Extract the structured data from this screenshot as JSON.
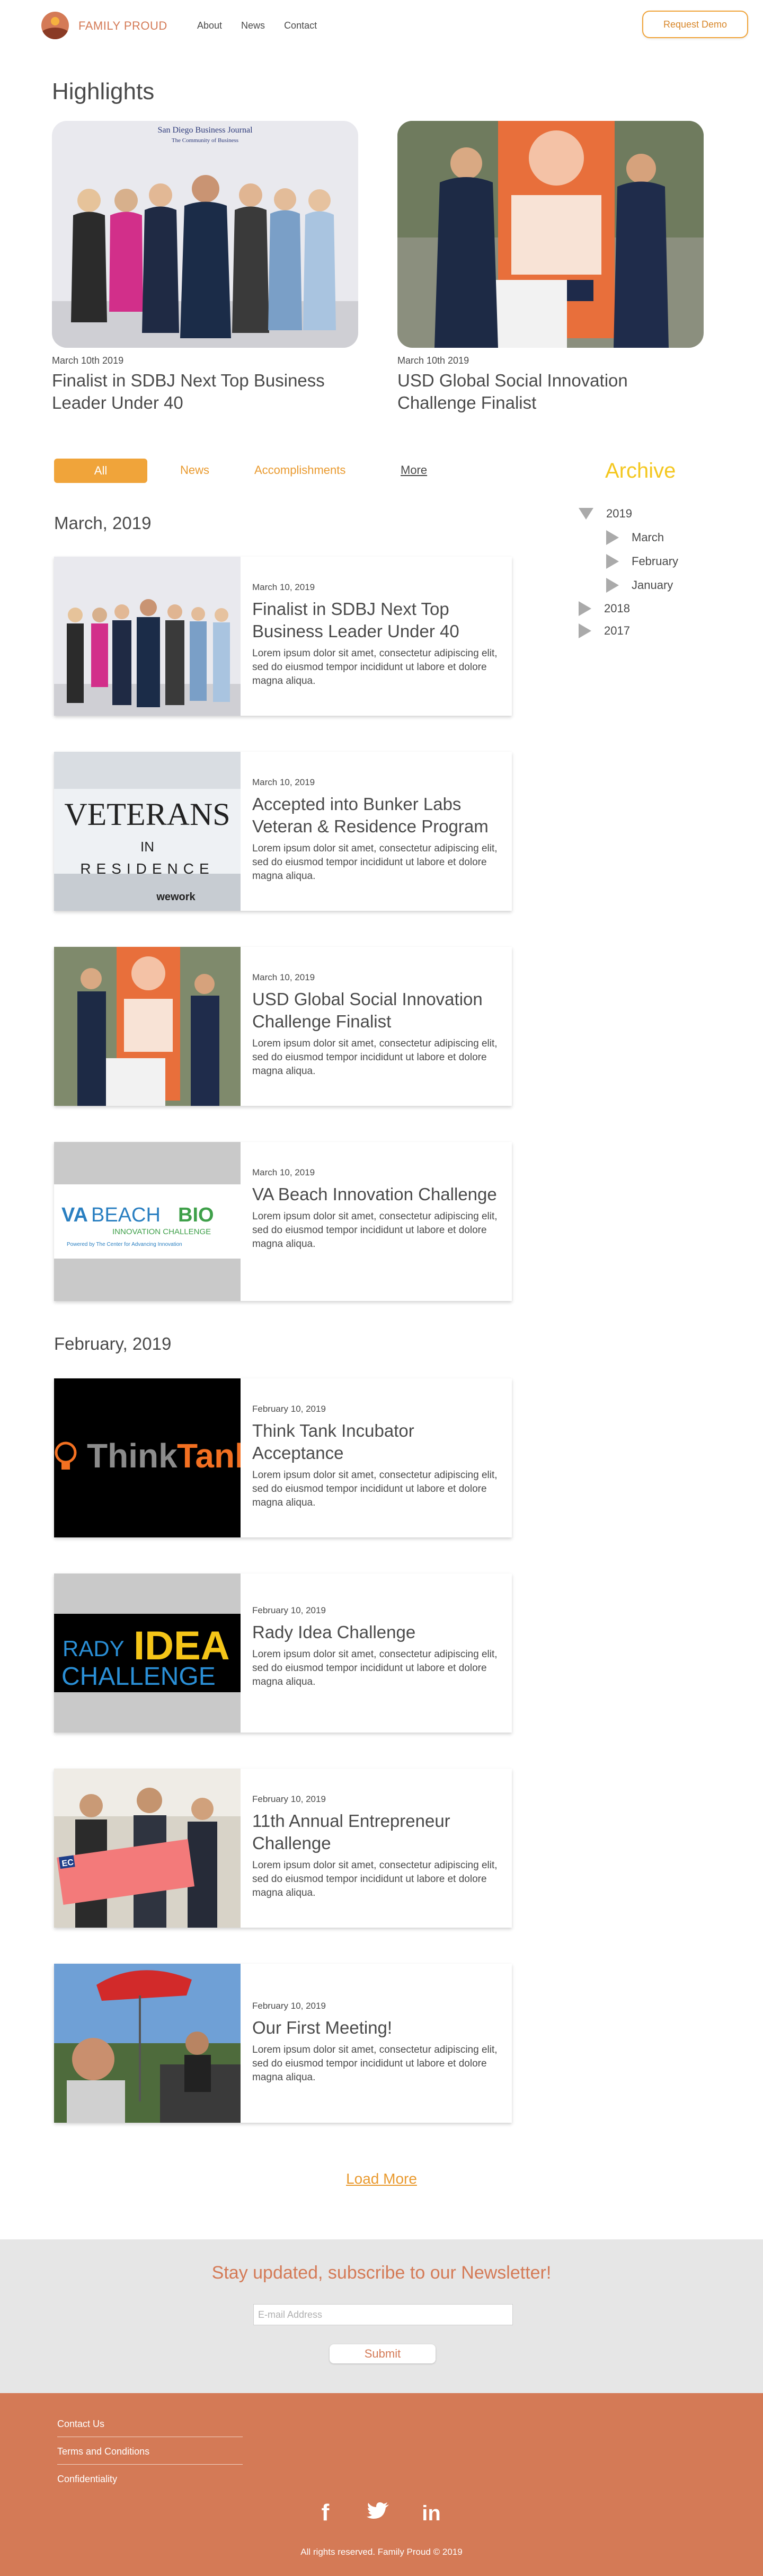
{
  "nav": {
    "brand": "FAMILY PROUD",
    "links": [
      "About",
      "News",
      "Contact"
    ],
    "demo_button": "Request Demo"
  },
  "highlights": {
    "title": "Highlights",
    "items": [
      {
        "date": "March 10th 2019",
        "headline": "Finalist in SDBJ Next Top Business Leader Under 40",
        "banner_line1": "San Diego Business Journal",
        "banner_line2": "The Community of Business"
      },
      {
        "date": "March 10th 2019",
        "headline": "USD Global Social Innovation Challenge Finalist"
      }
    ]
  },
  "filters": {
    "all": "All",
    "news": "News",
    "accomplishments": "Accomplishments",
    "more": "More"
  },
  "archive": {
    "title": "Archive",
    "year_2019": "2019",
    "months": [
      "March",
      "February",
      "January"
    ],
    "year_2018": "2018",
    "year_2017": "2017"
  },
  "months": {
    "march": "March, 2019",
    "february": "February, 2019"
  },
  "cards": [
    {
      "date": "March 10, 2019",
      "title": "Finalist in SDBJ Next Top Business Leader Under 40",
      "desc": "Lorem ipsum dolor sit amet, consectetur adipiscing elit, sed do eiusmod tempor incididunt ut labore et dolore magna aliqua."
    },
    {
      "date": "March 10, 2019",
      "title": "Accepted into Bunker Labs Veteran & Residence Program",
      "desc": "Lorem ipsum dolor sit amet, consectetur adipiscing elit, sed do eiusmod tempor incididunt ut labore et dolore magna aliqua.",
      "logo_top": "VETERANS",
      "logo_mid": "IN",
      "logo_bottom": "RESIDENCE",
      "logo_foot": "wework"
    },
    {
      "date": "March 10, 2019",
      "title": "USD Global Social Innovation Challenge Finalist",
      "desc": "Lorem ipsum dolor sit amet, consectetur adipiscing elit, sed do eiusmod tempor incididunt ut labore et dolore magna aliqua."
    },
    {
      "date": "March 10, 2019",
      "title": "VA Beach Innovation Challenge",
      "desc": "Lorem ipsum dolor sit amet, consectetur adipiscing elit, sed do eiusmod tempor incididunt ut labore et dolore magna aliqua.",
      "logo_a": "VA",
      "logo_b": "BEACH",
      "logo_c": "BIO",
      "logo_sub": "INNOVATION CHALLENGE",
      "logo_powered": "Powered by The Center for Advancing Innovation"
    },
    {
      "date": "February 10, 2019",
      "title": "Think Tank Incubator Acceptance",
      "desc": "Lorem ipsum dolor sit amet, consectetur adipiscing elit, sed do eiusmod tempor incididunt ut labore et dolore magna aliqua.",
      "logo_a": "Think",
      "logo_b": "Tank"
    },
    {
      "date": "February 10, 2019",
      "title": "Rady Idea Challenge",
      "desc": "Lorem ipsum dolor sit amet, consectetur adipiscing elit, sed do eiusmod tempor incididunt ut labore et dolore magna aliqua.",
      "logo_a": "RADY",
      "logo_b": "IDEA",
      "logo_c": "CHALLENGE"
    },
    {
      "date": "February 10, 2019",
      "title": "11th Annual Entrepreneur Challenge",
      "desc": "Lorem ipsum dolor sit amet, consectetur adipiscing elit, sed do eiusmod tempor incididunt ut labore et dolore magna aliqua.",
      "logo_a": "EC"
    },
    {
      "date": "February 10, 2019",
      "title": "Our First Meeting!",
      "desc": "Lorem ipsum dolor sit amet, consectetur adipiscing elit, sed do eiusmod tempor incididunt ut labore et dolore magna aliqua."
    }
  ],
  "load_more": "Load More",
  "newsletter": {
    "title": "Stay updated, subscribe to our Newsletter!",
    "placeholder": "E-mail Address",
    "submit": "Submit"
  },
  "footer": {
    "links": [
      "Contact Us",
      "Terms and Conditions",
      "Confidentiality"
    ],
    "social": {
      "facebook": "f",
      "linkedin": "in"
    },
    "copyright": "All rights reserved. Family Proud © 2019"
  },
  "colors": {
    "accent_orange": "#f0a43a",
    "brand_terracotta": "#d47a56",
    "archive_yellow": "#f4c71f",
    "gray_text": "#4a4a4a"
  }
}
